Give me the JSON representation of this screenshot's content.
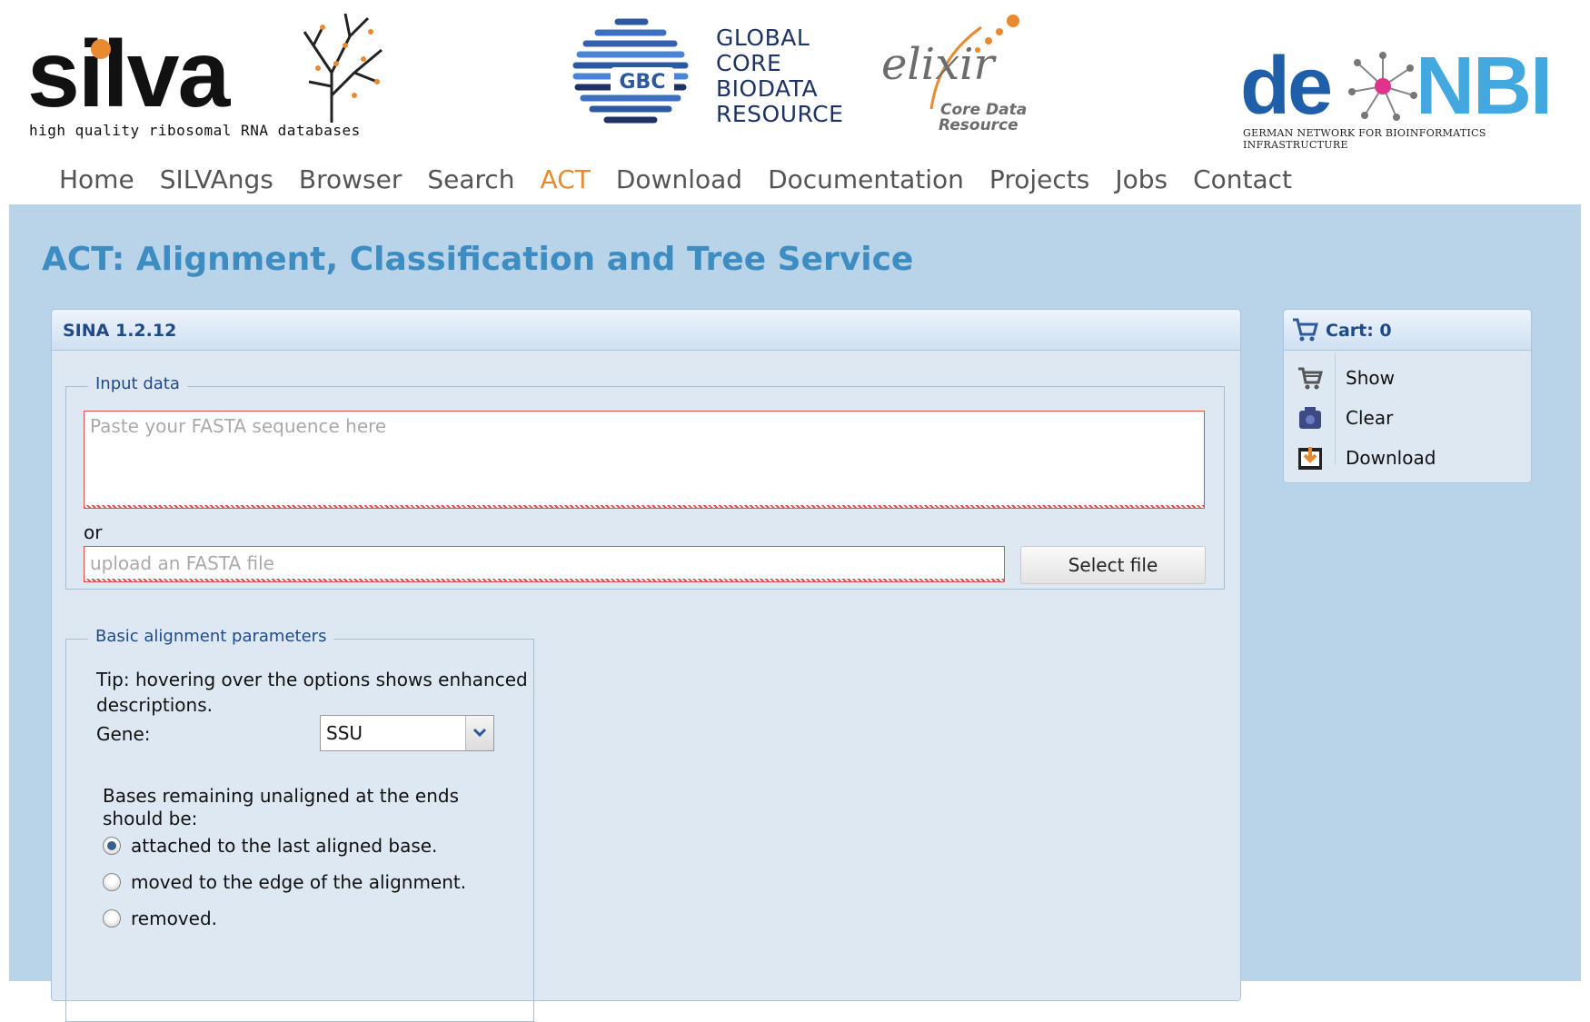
{
  "header": {
    "silva": {
      "word": "silva",
      "tagline": "high quality ribosomal RNA databases"
    },
    "gbc": {
      "lines": [
        "GLOBAL",
        "CORE",
        "BIODATA",
        "RESOURCE"
      ],
      "badge": "GBC"
    },
    "elixir": {
      "word": "elixir",
      "sub_line1": "Core Data",
      "sub_line2": "Resource"
    },
    "denbi": {
      "de": "de",
      "nbi": "NBI",
      "tagline": "GERMAN NETWORK FOR BIOINFORMATICS INFRASTRUCTURE"
    },
    "nav": [
      "Home",
      "SILVAngs",
      "Browser",
      "Search",
      "ACT",
      "Download",
      "Documentation",
      "Projects",
      "Jobs",
      "Contact"
    ],
    "active_nav": "ACT"
  },
  "page": {
    "title": "ACT: Alignment, Classification and Tree Service"
  },
  "sina": {
    "title": "SINA 1.2.12",
    "input": {
      "legend": "Input data",
      "fasta_placeholder": "Paste your FASTA sequence here",
      "or_label": "or",
      "file_placeholder": "upload an FASTA file",
      "select_file_label": "Select file"
    },
    "params": {
      "legend": "Basic alignment parameters",
      "tip_line1": "Tip: hovering over the options shows enhanced",
      "tip_line2": "descriptions.",
      "gene_label": "Gene:",
      "gene_value": "SSU",
      "ends_line1": "Bases remaining unaligned at the ends",
      "ends_line2": "should be:",
      "options": [
        "attached to the last aligned base.",
        "moved to the edge of the alignment.",
        "removed."
      ],
      "selected_index": 0
    }
  },
  "cart": {
    "title": "Cart: 0",
    "items": [
      "Show",
      "Clear",
      "Download"
    ]
  },
  "colors": {
    "accent": "#e88a2f",
    "title_blue": "#3d8dc2",
    "panel_bg": "#dde8f3",
    "page_bg": "#b9d4e8"
  }
}
